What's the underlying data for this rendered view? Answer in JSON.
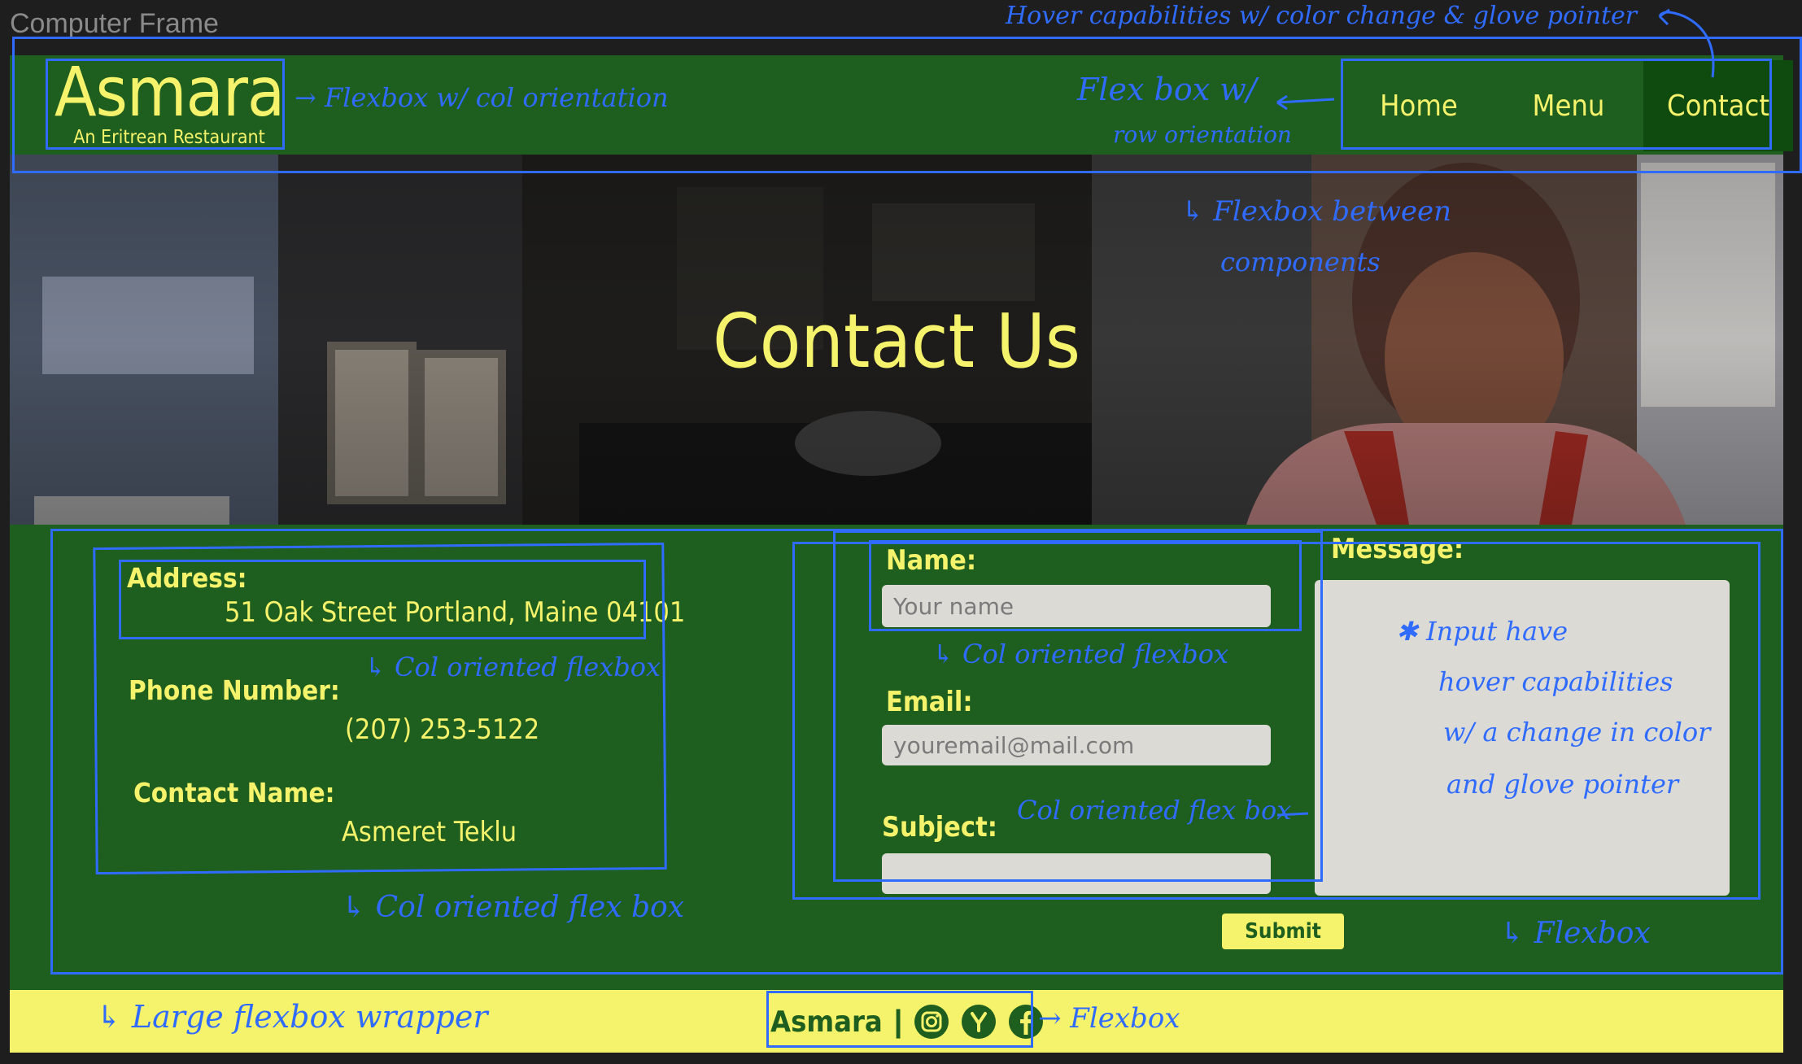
{
  "frame_label": "Computer Frame",
  "brand": {
    "name": "Asmara",
    "tagline": "An Eritrean Restaurant"
  },
  "nav": {
    "items": [
      {
        "label": "Home"
      },
      {
        "label": "Menu"
      },
      {
        "label": "Contact"
      }
    ],
    "active": "Contact"
  },
  "hero": {
    "title": "Contact Us"
  },
  "info": {
    "address_label": "Address:",
    "address_value": "51 Oak Street Portland, Maine  04101",
    "phone_label": "Phone Number:",
    "phone_value": "(207) 253-5122",
    "contact_label": "Contact Name:",
    "contact_value": "Asmeret Teklu"
  },
  "form": {
    "name_label": "Name:",
    "name_placeholder": "Your name",
    "email_label": "Email:",
    "email_placeholder": "youremail@mail.com",
    "subject_label": "Subject:",
    "subject_placeholder": "",
    "message_label": "Message:",
    "submit_label": "Submit"
  },
  "footer": {
    "brand": "Asmara",
    "separator": "|",
    "social_icons": [
      "instagram-icon",
      "yelp-icon",
      "facebook-icon"
    ]
  },
  "annotations": {
    "header_hover": "Hover capabilities w/ color change & glove pointer",
    "brand_flex": "→ Flexbox w/ col orientation",
    "nav_flex_1": "Flex box w/",
    "nav_flex_2": "row orientation",
    "between_1": "↳ Flexbox between",
    "between_2": "components",
    "address_flex": "↳ Col oriented flexbox",
    "info_flex": "↳ Col oriented flex box",
    "name_flex": "↳ Col oriented flexbox",
    "form_flex": "Col oriented flex box",
    "input_hover_1": "✱ Input have",
    "input_hover_2": "hover capabilities",
    "input_hover_3": "w/ a change in color",
    "input_hover_4": "and glove pointer",
    "flexbox": "↳ Flexbox",
    "wrapper": "↳ Large flexbox wrapper",
    "footer_flex": "→ Flexbox"
  },
  "colors": {
    "green": "#1e5e1e",
    "dark_green": "#0f4a0f",
    "yellow": "#f5f26b",
    "annotation_blue": "#2f6bff",
    "input_gray": "#dcdad5"
  }
}
